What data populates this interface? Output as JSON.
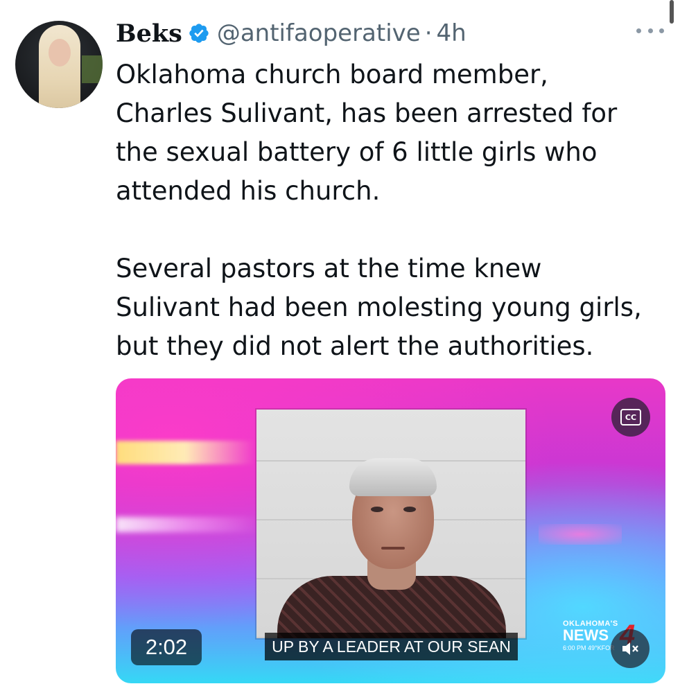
{
  "author": {
    "display_name": "Beks",
    "handle": "@antifaoperative",
    "separator": "·",
    "timestamp": "4h",
    "verified": true
  },
  "tweet": {
    "text": "Oklahoma church board member,\nCharles Sulivant, has been arrested for\nthe sexual battery of 6 little girls who\nattended his church.\n\nSeveral pastors at the time knew\nSulivant had been molesting young girls,\nbut they did not alert the authorities."
  },
  "media": {
    "duration": "2:02",
    "caption_text": "UP BY A LEADER AT OUR SEAN",
    "cc_label": "CC",
    "logo": {
      "top": "OKLAHOMA'S",
      "name": "NEWS",
      "number": "4",
      "bottom": "6:00 PM  49°KFOR"
    }
  },
  "icons": {
    "verified": "verified-badge-icon",
    "more": "more-options-icon",
    "cc": "closed-captions-icon",
    "mute": "muted-speaker-icon"
  },
  "colors": {
    "verified_blue": "#1d9bf0",
    "secondary_text": "#536471",
    "primary_text": "#0f1419"
  }
}
